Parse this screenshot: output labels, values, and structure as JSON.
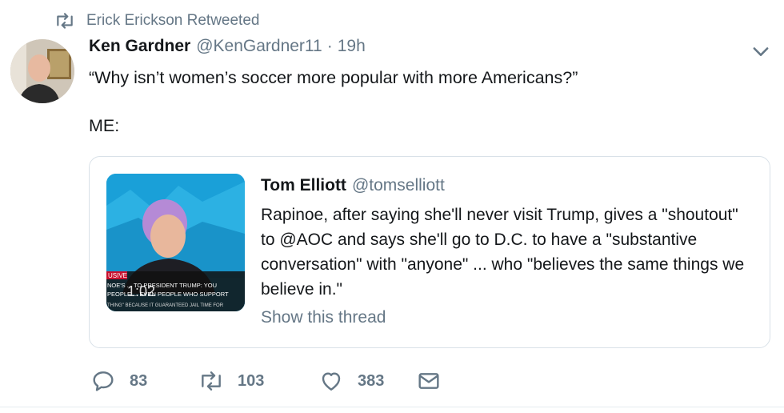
{
  "retweet_notice": {
    "icon": "retweet-icon",
    "text": "Erick Erickson Retweeted"
  },
  "tweet": {
    "author_name": "Ken Gardner",
    "author_handle": "@KenGardner11",
    "separator": "·",
    "time": "19h",
    "text_line1": "“Why isn’t women’s soccer more popular with more Americans?”",
    "text_line2": "ME:"
  },
  "quote": {
    "author_name": "Tom Elliott",
    "author_handle": "@tomselliott",
    "text": "Rapinoe, after saying she'll never visit Trump, gives a \"shoutout\" to @AOC and says she'll go to D.C. to have a \"substantive conversation\" with \"anyone\" ... who \"believes the same things we believe in.\"",
    "show_thread": "Show this thread",
    "media": {
      "badge": "USIVE",
      "ticker_line1": "NOE'S ... TO PRESIDENT TRUMP: YOU",
      "ticker_line2": "PEOPLE ... EVEN PEOPLE WHO SUPPORT",
      "ticker_line3": "THING\" BECAUSE IT GUARANTEED JAIL TIME FOR",
      "timer": "1:02"
    }
  },
  "actions": {
    "reply_count": "83",
    "retweet_count": "103",
    "like_count": "383"
  },
  "colors": {
    "secondary_text": "#657786",
    "border": "#d9e1e8",
    "cnn_blue": "#1aa0d8"
  }
}
